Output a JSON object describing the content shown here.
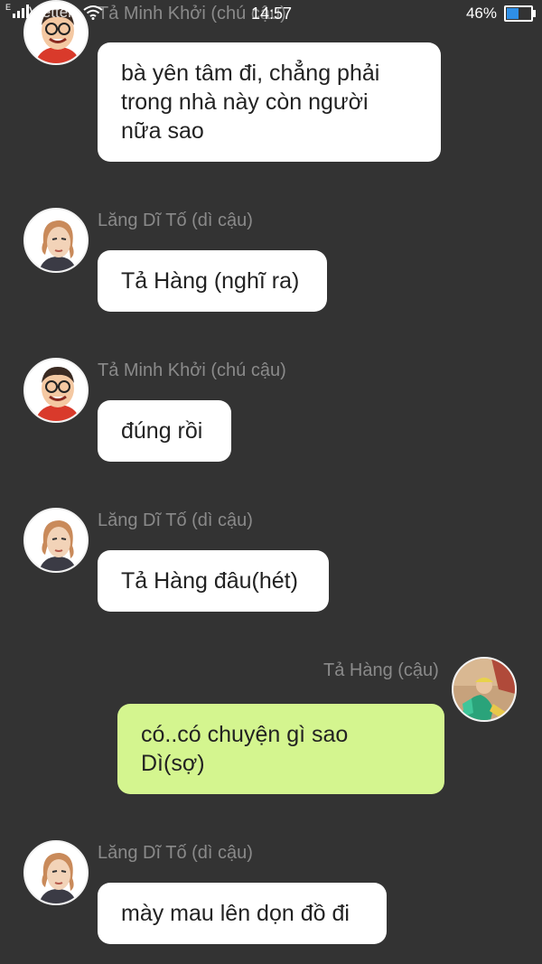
{
  "status_bar": {
    "carrier": "Viettel",
    "network_type": "E",
    "time": "14:57",
    "battery_percent": "46%",
    "battery_level": 0.46
  },
  "messages": [
    {
      "sender": "Tả Minh Khởi (chú cậu)",
      "text": "bà yên tâm đi, chẳng phải\ntrong nhà này còn người\nnữa sao",
      "avatar": "avatar-uncle",
      "side": "left"
    },
    {
      "sender": "Lăng Dĩ Tố (dì cậu)",
      "text": "Tả Hàng (nghĩ ra)",
      "avatar": "avatar-aunt",
      "side": "left"
    },
    {
      "sender": "Tả Minh Khởi (chú cậu)",
      "text": "đúng rồi",
      "avatar": "avatar-uncle",
      "side": "left"
    },
    {
      "sender": "Lăng Dĩ Tố (dì cậu)",
      "text": "Tả Hàng đâu(hét)",
      "avatar": "avatar-aunt",
      "side": "left"
    },
    {
      "sender": "Tả Hàng (cậu)",
      "text": "có..có chuyện gì sao\nDì(sợ)",
      "avatar": "avatar-self",
      "side": "right"
    },
    {
      "sender": "Lăng Dĩ Tố (dì cậu)",
      "text": "mày mau lên dọn đồ đi",
      "avatar": "avatar-aunt",
      "side": "left"
    }
  ],
  "colors": {
    "background": "#333333",
    "bubble_other": "#ffffff",
    "bubble_self": "#d4f58f",
    "sender_name": "#8a8a8a",
    "battery_fill": "#2f8fe6"
  }
}
